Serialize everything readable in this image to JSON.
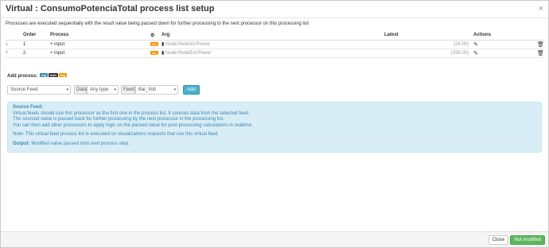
{
  "header": {
    "title_prefix": "Virtual : ",
    "feed_name": "ConsumoPotenciaTotal",
    "title_suffix": " process list setup",
    "close_glyph": "×"
  },
  "intro": "Processes are executed sequentially with the result value being passed down for further processing to the next processor on this processing list",
  "table": {
    "headers": {
      "order": "Order",
      "process": "Process",
      "arg": "Arg",
      "latest": "Latest",
      "actions": "Actions"
    },
    "rows": [
      {
        "move": "↓",
        "order": "1",
        "process": "+ input",
        "tag": "tag",
        "arg": "Node:RedeInt:Power",
        "latest": "(26.00)"
      },
      {
        "move": "↑",
        "order": "2",
        "process": "+ input",
        "tag": "tag",
        "arg": "Node:RedeExt:Power",
        "latest": "(338.00)"
      }
    ]
  },
  "add_process": {
    "label": "Add process:",
    "badges": [
      "log",
      "kwh",
      "rep"
    ],
    "process_select": "Source Feed",
    "data_label": "Data",
    "data_select": "Any type",
    "feed_label": "Feed",
    "feed_select": "Bal_Volt",
    "add_button": "Add"
  },
  "info": {
    "title": "Source Feed:",
    "line1": "Virtual feeds should use this processor as the first one in the process list. It sources data from the selected feed.",
    "line2": "The sourced value is passed back for further processing by the next processor in the processing list.",
    "line3": "You can then add other processors to apply logic on the passed value for post-processing calculations in realtime.",
    "note": "Note: This virtual feed process list is executed on visualizations requests that use this virtual feed.",
    "output_label": "Output:",
    "output_text": " Modified value passed onto next process step."
  },
  "footer": {
    "close_button": "Close",
    "status_button": "Not modified"
  },
  "colors": {
    "info_bg": "#d9edf7",
    "info_text": "#3a87ad",
    "tag_orange": "#f89406",
    "add_button": "#49afcd",
    "status_green": "#5bb75b"
  }
}
